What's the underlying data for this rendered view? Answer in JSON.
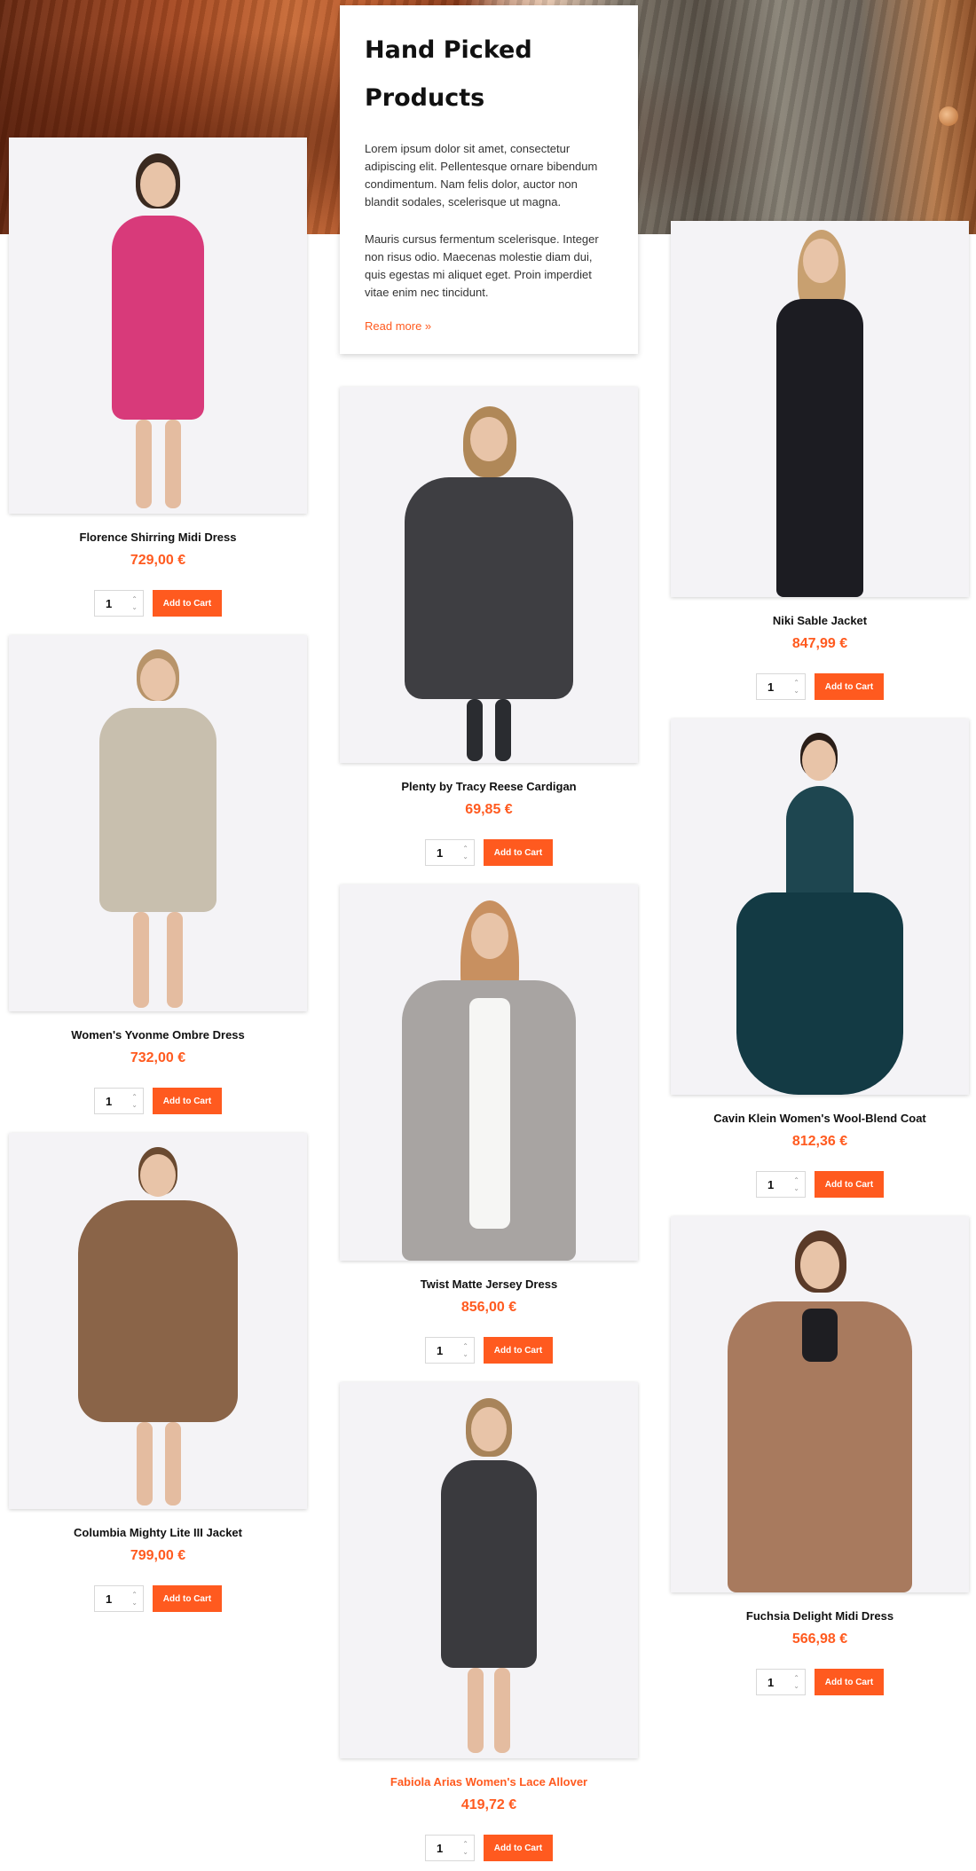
{
  "intro": {
    "title": "Hand Picked Products",
    "paragraph1": "Lorem ipsum dolor sit amet, consectetur adipiscing elit. Pellentesque ornare bibendum condimentum. Nam felis dolor, auctor non blandit sodales, scelerisque ut magna.",
    "paragraph2": "Mauris cursus fermentum scelerisque. Integer non risus odio. Maecenas molestie diam dui, quis egestas mi aliquet eget. Proin imperdiet vitae enim nec tincidunt.",
    "read_more": "Read more »"
  },
  "cart_button_label": "Add to Cart",
  "products": [
    {
      "name": "Florence Shirring Midi Dress",
      "price": "729,00 €",
      "qty": "1"
    },
    {
      "name": "Plenty by Tracy Reese Cardigan",
      "price": "69,85 €",
      "qty": "1"
    },
    {
      "name": "Niki Sable Jacket",
      "price": "847,99 €",
      "qty": "1"
    },
    {
      "name": "Women's Yvonme Ombre Dress",
      "price": "732,00 €",
      "qty": "1"
    },
    {
      "name": "Twist Matte Jersey Dress",
      "price": "856,00 €",
      "qty": "1"
    },
    {
      "name": "Cavin Klein Women's Wool-Blend Coat",
      "price": "812,36 €",
      "qty": "1"
    },
    {
      "name": "Columbia Mighty Lite III Jacket",
      "price": "799,00 €",
      "qty": "1"
    },
    {
      "name": "Fabiola Arias Women's Lace Allover",
      "price": "419,72 €",
      "qty": "1"
    },
    {
      "name": "Fuchsia Delight Midi Dress",
      "price": "566,98 €",
      "qty": "1"
    }
  ],
  "colors": {
    "accent": "#ff5a1f",
    "card_bg": "#f4f3f6"
  }
}
